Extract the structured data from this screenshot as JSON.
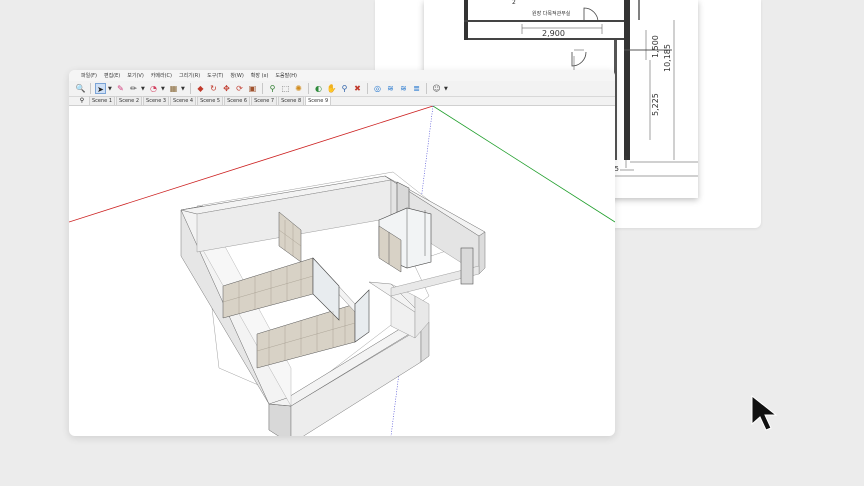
{
  "plan": {
    "room_label": "원장 다목적관무실",
    "dim_width": "2,900",
    "dim_height_total": "10,185",
    "dim_height_part": "5,225",
    "dim_small_top": "1,500",
    "dim_bottom": "05",
    "dim_top_left": "2"
  },
  "menubar": {
    "items": [
      "파일(F)",
      "편집(E)",
      "보기(V)",
      "카메라(C)",
      "그리기(R)",
      "도구(T)",
      "창(W)",
      "확장 (x)",
      "도움말(H)"
    ]
  },
  "toolbar": {
    "icons": [
      "magnifier-icon",
      "select-arrow-icon",
      "eraser-icon",
      "pencil-icon",
      "paint-bucket-icon",
      "material-icon",
      "push-pull-icon",
      "rotate-icon",
      "move-icon",
      "scale-icon",
      "component-icon",
      "zoom-icon",
      "zoom-window-icon",
      "walk-icon",
      "orbit-icon",
      "section-icon",
      "zoom-extents-icon",
      "x-ray-icon",
      "layers-icon",
      "styles-icon",
      "shadows-icon",
      "fog-icon",
      "profile-icon"
    ]
  },
  "tabs": {
    "items": [
      "Scene 1",
      "Scene 2",
      "Scene 3",
      "Scene 4",
      "Scene 5",
      "Scene 6",
      "Scene 7",
      "Scene 8",
      "Scene 9"
    ],
    "active_index": 8
  },
  "colors": {
    "axis_red": "#cc2020",
    "axis_green": "#1e9e2a",
    "axis_blue": "#3a3ad0",
    "wall_top": "#f3f3f3",
    "wall_side": "#e2e2e2",
    "floor": "#ffffff",
    "panel": "#d8d2c6"
  }
}
